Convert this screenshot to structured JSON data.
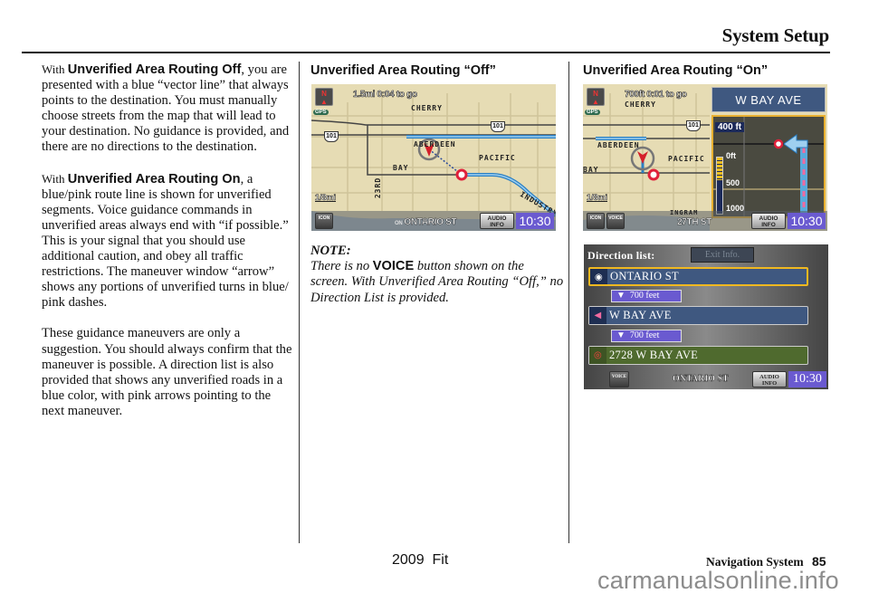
{
  "header": {
    "title": "System Setup"
  },
  "column1": {
    "para1": {
      "lead": "With ",
      "term": "Unverified Area Routing Off",
      "body": ", you are presented with a blue “vector line” that always points to the destination. You must manually choose streets from the map that will lead to your destination. No guidance is provided, and there are no directions to the destination."
    },
    "para2": {
      "lead": "With ",
      "term": "Unverified Area Routing On",
      "body": ", a blue/pink route line is shown for unverified segments. Voice guidance commands in unverified areas always end with “if possible.” This is your signal that you should use additional caution, and obey all traffic restrictions. The maneuver window “arrow” shows any portions of unverified turns in blue/ pink dashes."
    },
    "para3": "These guidance maneuvers are only a suggestion. You should always confirm that the maneuver is possible. A direction list is also provided that shows any unverified roads in a blue color, with pink arrows pointing to the next maneuver."
  },
  "column2": {
    "heading": "Unverified Area Routing “Off”",
    "screen": {
      "compass": "N",
      "gps": "GPS",
      "distance_to_go": "1.5mi 0:04 to go",
      "scale": "1/8mi",
      "highway": "101",
      "labels": [
        "CHERRY",
        "ABERDEEN",
        "PACIFIC",
        "BAY",
        "23RD",
        "INDUSTRY"
      ],
      "on_label": "ON",
      "current_street": "ONTARIO ST",
      "icon_button": "ICON",
      "audio_button": "AUDIO INFO",
      "clock": "10:30"
    },
    "note": {
      "title": "NOTE:",
      "text_before": "There is no ",
      "voice_word": "VOICE",
      "text_after": " button shown on the screen. With Unverified Area Routing “Off,” no Direction List is provided."
    }
  },
  "column3": {
    "heading": "Unverified Area Routing “On”",
    "screen": {
      "compass": "N",
      "gps": "GPS",
      "distance_to_go": "700ft 0:01 to go",
      "scale": "1/8mi",
      "highway": "101",
      "labels": [
        "CHERRY",
        "ABERDEEN",
        "PACIFIC",
        "BAY"
      ],
      "next_street": "W BAY AVE",
      "maneuver_distance": "400 ft",
      "maneuver_ticks": [
        "0ft",
        "500",
        "1000"
      ],
      "maneuver_progress_percent": 40,
      "cross_street": "INGRAM",
      "current_street": "27TH ST",
      "icon_button": "ICON",
      "voice_button": "VOICE",
      "audio_button": "AUDIO INFO",
      "clock": "10:30"
    },
    "direction_list": {
      "title": "Direction list:",
      "exit_info": "Exit Info.",
      "rows": [
        {
          "street": "ONTARIO ST",
          "icon": "compass-icon",
          "color": "#3f5880",
          "selected": true
        },
        {
          "distance": "700 feet"
        },
        {
          "street": "W BAY AVE",
          "icon": "turn-left-icon",
          "color": "#3f5880",
          "selected": false
        },
        {
          "distance": "700 feet"
        },
        {
          "street": "2728 W BAY AVE",
          "icon": "destination-icon",
          "color": "#4f6a2e",
          "selected": false
        }
      ],
      "voice_button": "VOICE",
      "current_street": "ONTARIO ST",
      "audio_button": "AUDIO INFO",
      "clock": "10:30"
    }
  },
  "footer": {
    "model": "2009  Fit",
    "section": "Navigation System",
    "page": "85",
    "watermark": "carmanualsonline.info"
  }
}
